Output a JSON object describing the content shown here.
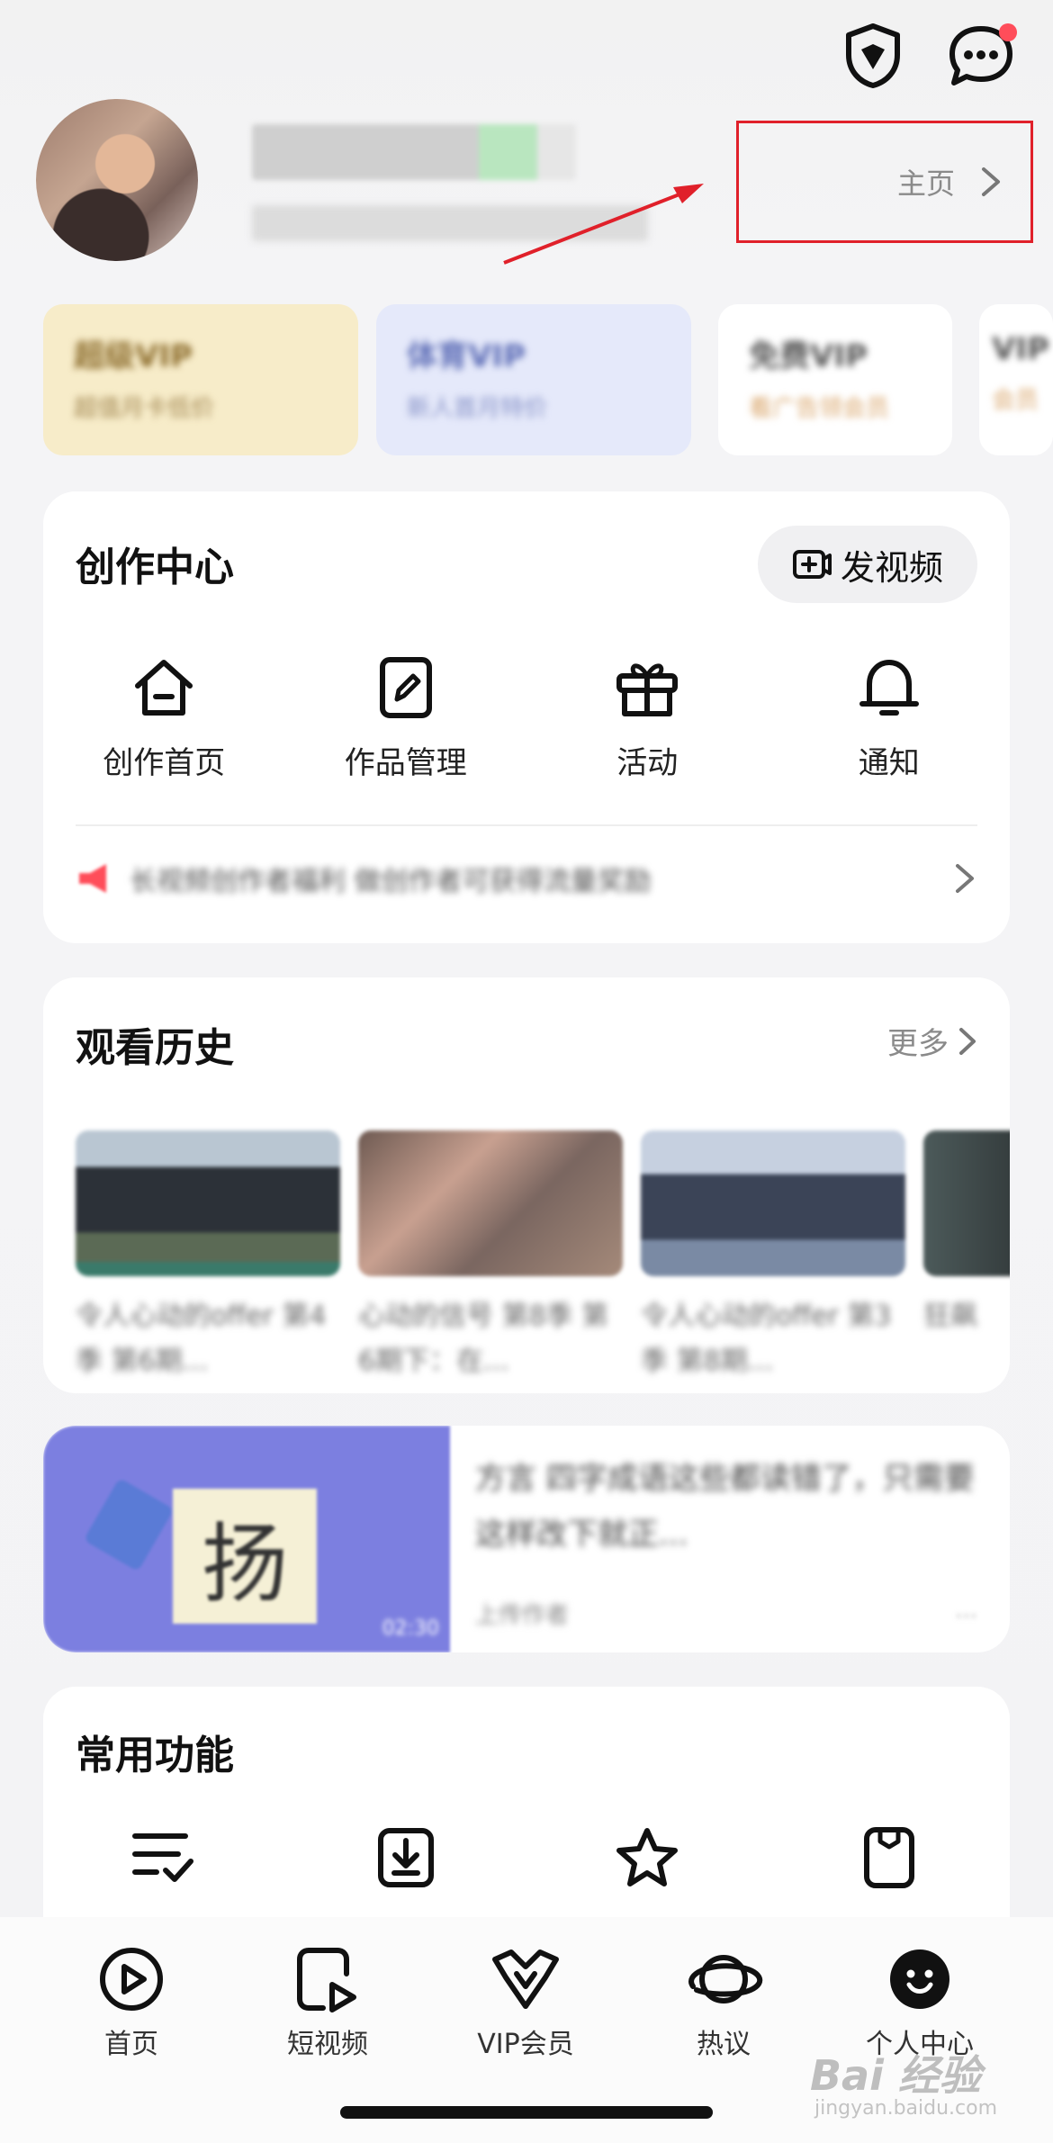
{
  "profile": {
    "home_label": "主页"
  },
  "vip_cards": [
    {
      "title": "超级VIP",
      "sub": "超值月卡低价",
      "bg": "#f7ecc9",
      "color": "#8a6a2a"
    },
    {
      "title": "体育VIP",
      "sub": "新人首月特价",
      "bg": "#e5e9fa",
      "color": "#5b6bb5"
    },
    {
      "title": "免费VIP",
      "sub": "看广告领会员",
      "bg": "#ffffff",
      "color": "#555555"
    },
    {
      "title": "VIP",
      "sub": "会员",
      "bg": "#ffffff",
      "color": "#555555"
    }
  ],
  "creation": {
    "title": "创作中心",
    "upload_label": "发视频",
    "items": [
      {
        "label": "创作首页",
        "icon": "home-icon"
      },
      {
        "label": "作品管理",
        "icon": "edit-icon"
      },
      {
        "label": "活动",
        "icon": "gift-icon"
      },
      {
        "label": "通知",
        "icon": "bell-icon"
      }
    ],
    "notice": "长视频创作者福利 做创作者可获得流量奖励"
  },
  "history": {
    "title": "观看历史",
    "more_label": "更多",
    "items": [
      {
        "caption": "令人心动的offer 第4季 第6期..."
      },
      {
        "caption": "心动的信号 第8季 第6期下：在..."
      },
      {
        "caption": "令人心动的offer 第3季 第8期..."
      },
      {
        "caption": "狂飙"
      }
    ]
  },
  "promo": {
    "thumb_char": "扬",
    "duration": "02:30",
    "title": "方言 四字成语这些都读错了，只需要这样改下就正...",
    "author": "上传作者",
    "meta": "..."
  },
  "common": {
    "title": "常用功能",
    "items": [
      {
        "icon": "list-check-icon"
      },
      {
        "icon": "download-icon"
      },
      {
        "icon": "star-icon"
      },
      {
        "icon": "bookmark-icon"
      }
    ]
  },
  "tabbar": {
    "items": [
      {
        "label": "首页",
        "icon": "play-icon"
      },
      {
        "label": "短视频",
        "icon": "short-video-icon"
      },
      {
        "label": "VIP会员",
        "icon": "vip-crown-icon"
      },
      {
        "label": "热议",
        "icon": "planet-icon"
      },
      {
        "label": "个人中心",
        "icon": "profile-face-icon"
      }
    ]
  },
  "watermark": {
    "main": "Bai 经验",
    "sub": "jingyan.baidu.com"
  },
  "colors": {
    "annotation_red": "#e0202a",
    "badge_red": "#ff4d5a"
  }
}
